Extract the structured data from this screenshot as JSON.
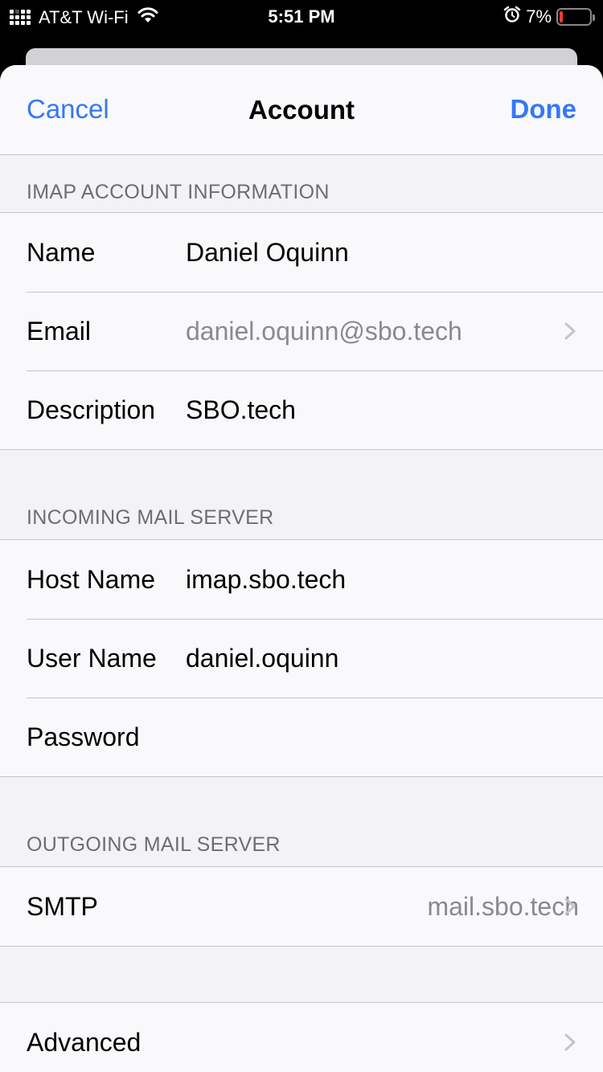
{
  "status_bar": {
    "carrier": "AT&T Wi-Fi",
    "time": "5:51 PM",
    "battery_percent": "7%",
    "battery_color": "#ff3b30"
  },
  "nav": {
    "cancel_label": "Cancel",
    "title": "Account",
    "done_label": "Done",
    "accent_color": "#3478f6"
  },
  "imap_section": {
    "header": "IMAP ACCOUNT INFORMATION",
    "name_label": "Name",
    "name_value": "Daniel Oquinn",
    "email_label": "Email",
    "email_value": "daniel.oquinn@sbo.tech",
    "description_label": "Description",
    "description_value": "SBO.tech"
  },
  "incoming_section": {
    "header": "INCOMING MAIL SERVER",
    "host_label": "Host Name",
    "host_value": "imap.sbo.tech",
    "user_label": "User Name",
    "user_value": "daniel.oquinn",
    "password_label": "Password",
    "password_value": ""
  },
  "outgoing_section": {
    "header": "OUTGOING MAIL SERVER",
    "smtp_label": "SMTP",
    "smtp_value": "mail.sbo.tech"
  },
  "advanced": {
    "label": "Advanced"
  },
  "icons": [
    "signal-icon",
    "wifi-icon",
    "alarm-icon",
    "battery-icon",
    "chevron-right-icon"
  ]
}
